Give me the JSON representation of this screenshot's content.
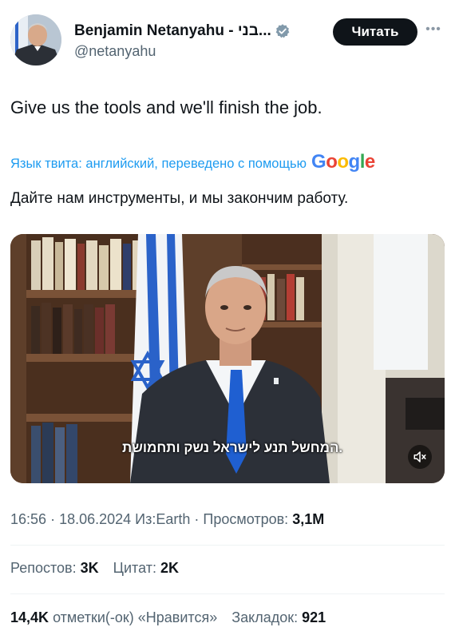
{
  "author": {
    "display_name": "Benjamin Netanyahu - בני...",
    "handle": "@netanyahu",
    "verified_icon": "verified-badge-icon",
    "avatar_icon": "avatar-photo"
  },
  "follow_button": {
    "label": "Читать"
  },
  "more_icon": "more-options-icon",
  "tweet": {
    "text": "Give us the tools and we'll finish the job.",
    "translation_label": "Язык твита: английский, переведено с помощью",
    "translation_provider": "Google",
    "translated_text": "Дайте нам инструменты, и мы закончим работу."
  },
  "media": {
    "subtitle": ".המחשל תנע לישראל נשק ותחמושת",
    "mute_icon": "muted-speaker-icon"
  },
  "meta": {
    "time": "16:56",
    "date": "18.06.2024",
    "source": "Из:Earth",
    "views_label": "Просмотров:",
    "views_count": "3,1M"
  },
  "stats": {
    "reposts_label": "Репостов:",
    "reposts_count": "3K",
    "quotes_label": "Цитат:",
    "quotes_count": "2K",
    "likes_count": "14,4K",
    "likes_label": "отметки(-ок) «Нравится»",
    "bookmarks_label": "Закладок:",
    "bookmarks_count": "921"
  },
  "colors": {
    "accent": "#1d9bf0",
    "text_primary": "#0f1419",
    "text_secondary": "#536471",
    "google_blue": "#4285f4",
    "google_red": "#ea4335",
    "google_yellow": "#fbbc05",
    "google_green": "#34a853"
  }
}
